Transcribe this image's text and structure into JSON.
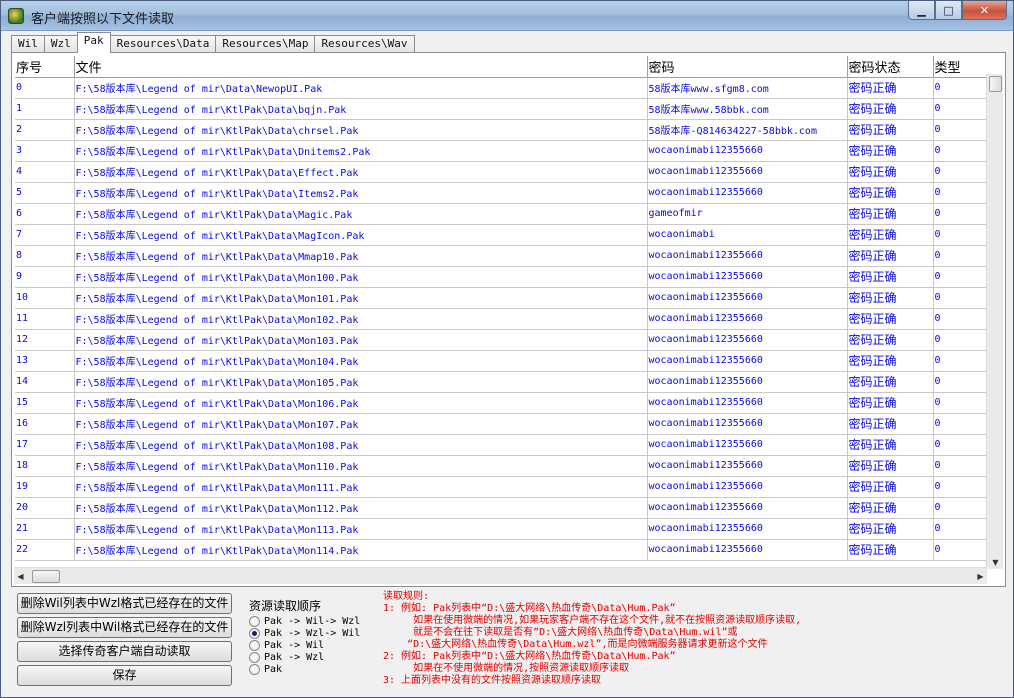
{
  "window": {
    "title": "客户端按照以下文件读取",
    "minimize": "▁",
    "maximize": "□",
    "close": "✕"
  },
  "tabs": [
    "Wil",
    "Wzl",
    "Pak",
    "Resources\\Data",
    "Resources\\Map",
    "Resources\\Wav"
  ],
  "active_tab": 2,
  "table": {
    "headers": [
      "序号",
      "文件",
      "密码",
      "密码状态",
      "类型"
    ],
    "rows": [
      [
        "0",
        "F:\\58版本库\\Legend of mir\\Data\\NewopUI.Pak",
        "58版本库www.sfgm8.com",
        "密码正确",
        "0"
      ],
      [
        "1",
        "F:\\58版本库\\Legend of mir\\KtlPak\\Data\\bqjn.Pak",
        "58版本库www.58bbk.com",
        "密码正确",
        "0"
      ],
      [
        "2",
        "F:\\58版本库\\Legend of mir\\KtlPak\\Data\\chrsel.Pak",
        "58版本库-Q814634227-58bbk.com",
        "密码正确",
        "0"
      ],
      [
        "3",
        "F:\\58版本库\\Legend of mir\\KtlPak\\Data\\Dnitems2.Pak",
        "wocaonimabi12355660",
        "密码正确",
        "0"
      ],
      [
        "4",
        "F:\\58版本库\\Legend of mir\\KtlPak\\Data\\Effect.Pak",
        "wocaonimabi12355660",
        "密码正确",
        "0"
      ],
      [
        "5",
        "F:\\58版本库\\Legend of mir\\KtlPak\\Data\\Items2.Pak",
        "wocaonimabi12355660",
        "密码正确",
        "0"
      ],
      [
        "6",
        "F:\\58版本库\\Legend of mir\\KtlPak\\Data\\Magic.Pak",
        "gameofmir",
        "密码正确",
        "0"
      ],
      [
        "7",
        "F:\\58版本库\\Legend of mir\\KtlPak\\Data\\MagIcon.Pak",
        "wocaonimabi",
        "密码正确",
        "0"
      ],
      [
        "8",
        "F:\\58版本库\\Legend of mir\\KtlPak\\Data\\Mmap10.Pak",
        "wocaonimabi12355660",
        "密码正确",
        "0"
      ],
      [
        "9",
        "F:\\58版本库\\Legend of mir\\KtlPak\\Data\\Mon100.Pak",
        "wocaonimabi12355660",
        "密码正确",
        "0"
      ],
      [
        "10",
        "F:\\58版本库\\Legend of mir\\KtlPak\\Data\\Mon101.Pak",
        "wocaonimabi12355660",
        "密码正确",
        "0"
      ],
      [
        "11",
        "F:\\58版本库\\Legend of mir\\KtlPak\\Data\\Mon102.Pak",
        "wocaonimabi12355660",
        "密码正确",
        "0"
      ],
      [
        "12",
        "F:\\58版本库\\Legend of mir\\KtlPak\\Data\\Mon103.Pak",
        "wocaonimabi12355660",
        "密码正确",
        "0"
      ],
      [
        "13",
        "F:\\58版本库\\Legend of mir\\KtlPak\\Data\\Mon104.Pak",
        "wocaonimabi12355660",
        "密码正确",
        "0"
      ],
      [
        "14",
        "F:\\58版本库\\Legend of mir\\KtlPak\\Data\\Mon105.Pak",
        "wocaonimabi12355660",
        "密码正确",
        "0"
      ],
      [
        "15",
        "F:\\58版本库\\Legend of mir\\KtlPak\\Data\\Mon106.Pak",
        "wocaonimabi12355660",
        "密码正确",
        "0"
      ],
      [
        "16",
        "F:\\58版本库\\Legend of mir\\KtlPak\\Data\\Mon107.Pak",
        "wocaonimabi12355660",
        "密码正确",
        "0"
      ],
      [
        "17",
        "F:\\58版本库\\Legend of mir\\KtlPak\\Data\\Mon108.Pak",
        "wocaonimabi12355660",
        "密码正确",
        "0"
      ],
      [
        "18",
        "F:\\58版本库\\Legend of mir\\KtlPak\\Data\\Mon110.Pak",
        "wocaonimabi12355660",
        "密码正确",
        "0"
      ],
      [
        "19",
        "F:\\58版本库\\Legend of mir\\KtlPak\\Data\\Mon111.Pak",
        "wocaonimabi12355660",
        "密码正确",
        "0"
      ],
      [
        "20",
        "F:\\58版本库\\Legend of mir\\KtlPak\\Data\\Mon112.Pak",
        "wocaonimabi12355660",
        "密码正确",
        "0"
      ],
      [
        "21",
        "F:\\58版本库\\Legend of mir\\KtlPak\\Data\\Mon113.Pak",
        "wocaonimabi12355660",
        "密码正确",
        "0"
      ],
      [
        "22",
        "F:\\58版本库\\Legend of mir\\KtlPak\\Data\\Mon114.Pak",
        "wocaonimabi12355660",
        "密码正确",
        "0"
      ]
    ]
  },
  "buttons": {
    "delete_wil": "删除Wil列表中Wzl格式已经存在的文件",
    "delete_wzl": "删除Wzl列表中Wil格式已经存在的文件",
    "select_client": "选择传奇客户端自动读取",
    "save": "保存"
  },
  "order_group": {
    "title": "资源读取顺序",
    "options": [
      "Pak -> Wil-> Wzl",
      "Pak -> Wzl-> Wil",
      "Pak -> Wil",
      "Pak -> Wzl",
      "Pak"
    ],
    "selected": 1
  },
  "rules": [
    "读取规则:",
    "1: 例如: Pak列表中“D:\\盛大网络\\热血传奇\\Data\\Hum.Pak”",
    "     如果在使用微端的情况,如果玩家客户端不存在这个文件,就不在按照资源读取顺序读取,",
    "     就是不会在往下读取是否有“D:\\盛大网络\\热血传奇\\Data\\Hum.wil”或",
    "    “D:\\盛大网络\\热血传奇\\Data\\Hum.wzl”,而是向微端服务器请求更新这个文件",
    "2: 例如: Pak列表中“D:\\盛大网络\\热血传奇\\Data\\Hum.Pak”",
    "     如果在不使用微端的情况,按照资源读取顺序读取",
    "3: 上面列表中没有的文件按照资源读取顺序读取"
  ]
}
